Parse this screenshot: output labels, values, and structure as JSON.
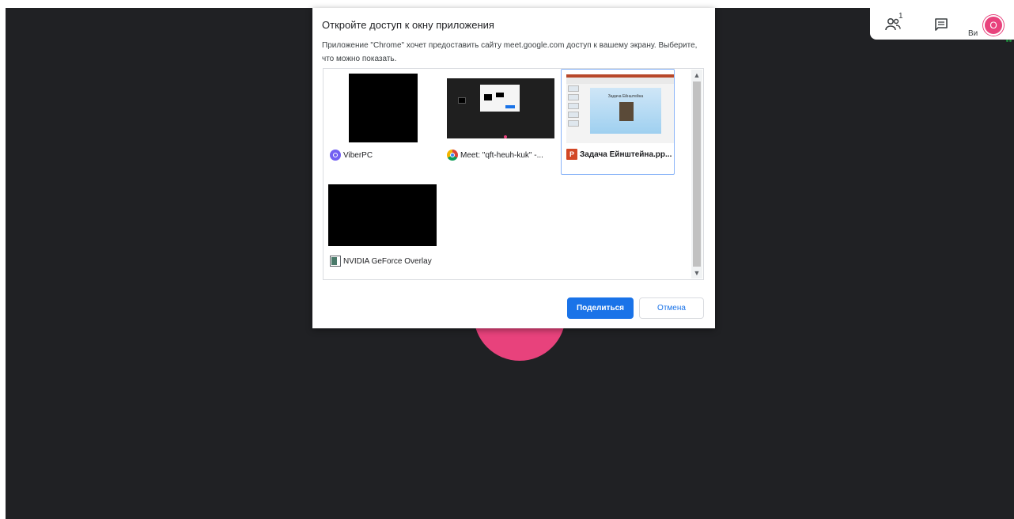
{
  "meet": {
    "participants_count": "1",
    "user_short": "Ви",
    "user_initial": "О"
  },
  "dialog": {
    "title": "Откройте доступ к окну приложения",
    "description": "Приложение \"Chrome\" хочет предоставить сайту meet.google.com доступ к вашему экрану. Выберите, что можно показать.",
    "sources": [
      {
        "label": "ViberPC",
        "icon": "viber-icon",
        "selected": false
      },
      {
        "label": "Meet: \"qft-heuh-kuk\" -...",
        "icon": "chrome-icon",
        "selected": false
      },
      {
        "label": "Задача Ейнштейна.pp...",
        "icon": "powerpoint-icon",
        "icon_text": "P",
        "selected": true
      },
      {
        "label": "NVIDIA GeForce Overlay",
        "icon": "nvidia-overlay-icon",
        "selected": false
      }
    ],
    "slide_title": "Задача Ейнштейна",
    "share_button": "Поделиться",
    "cancel_button": "Отмена"
  },
  "colors": {
    "stage_bg": "#202124",
    "accent_pink": "#e8427c",
    "primary_blue": "#1a73e8",
    "selection_border": "#8ab4f8"
  }
}
